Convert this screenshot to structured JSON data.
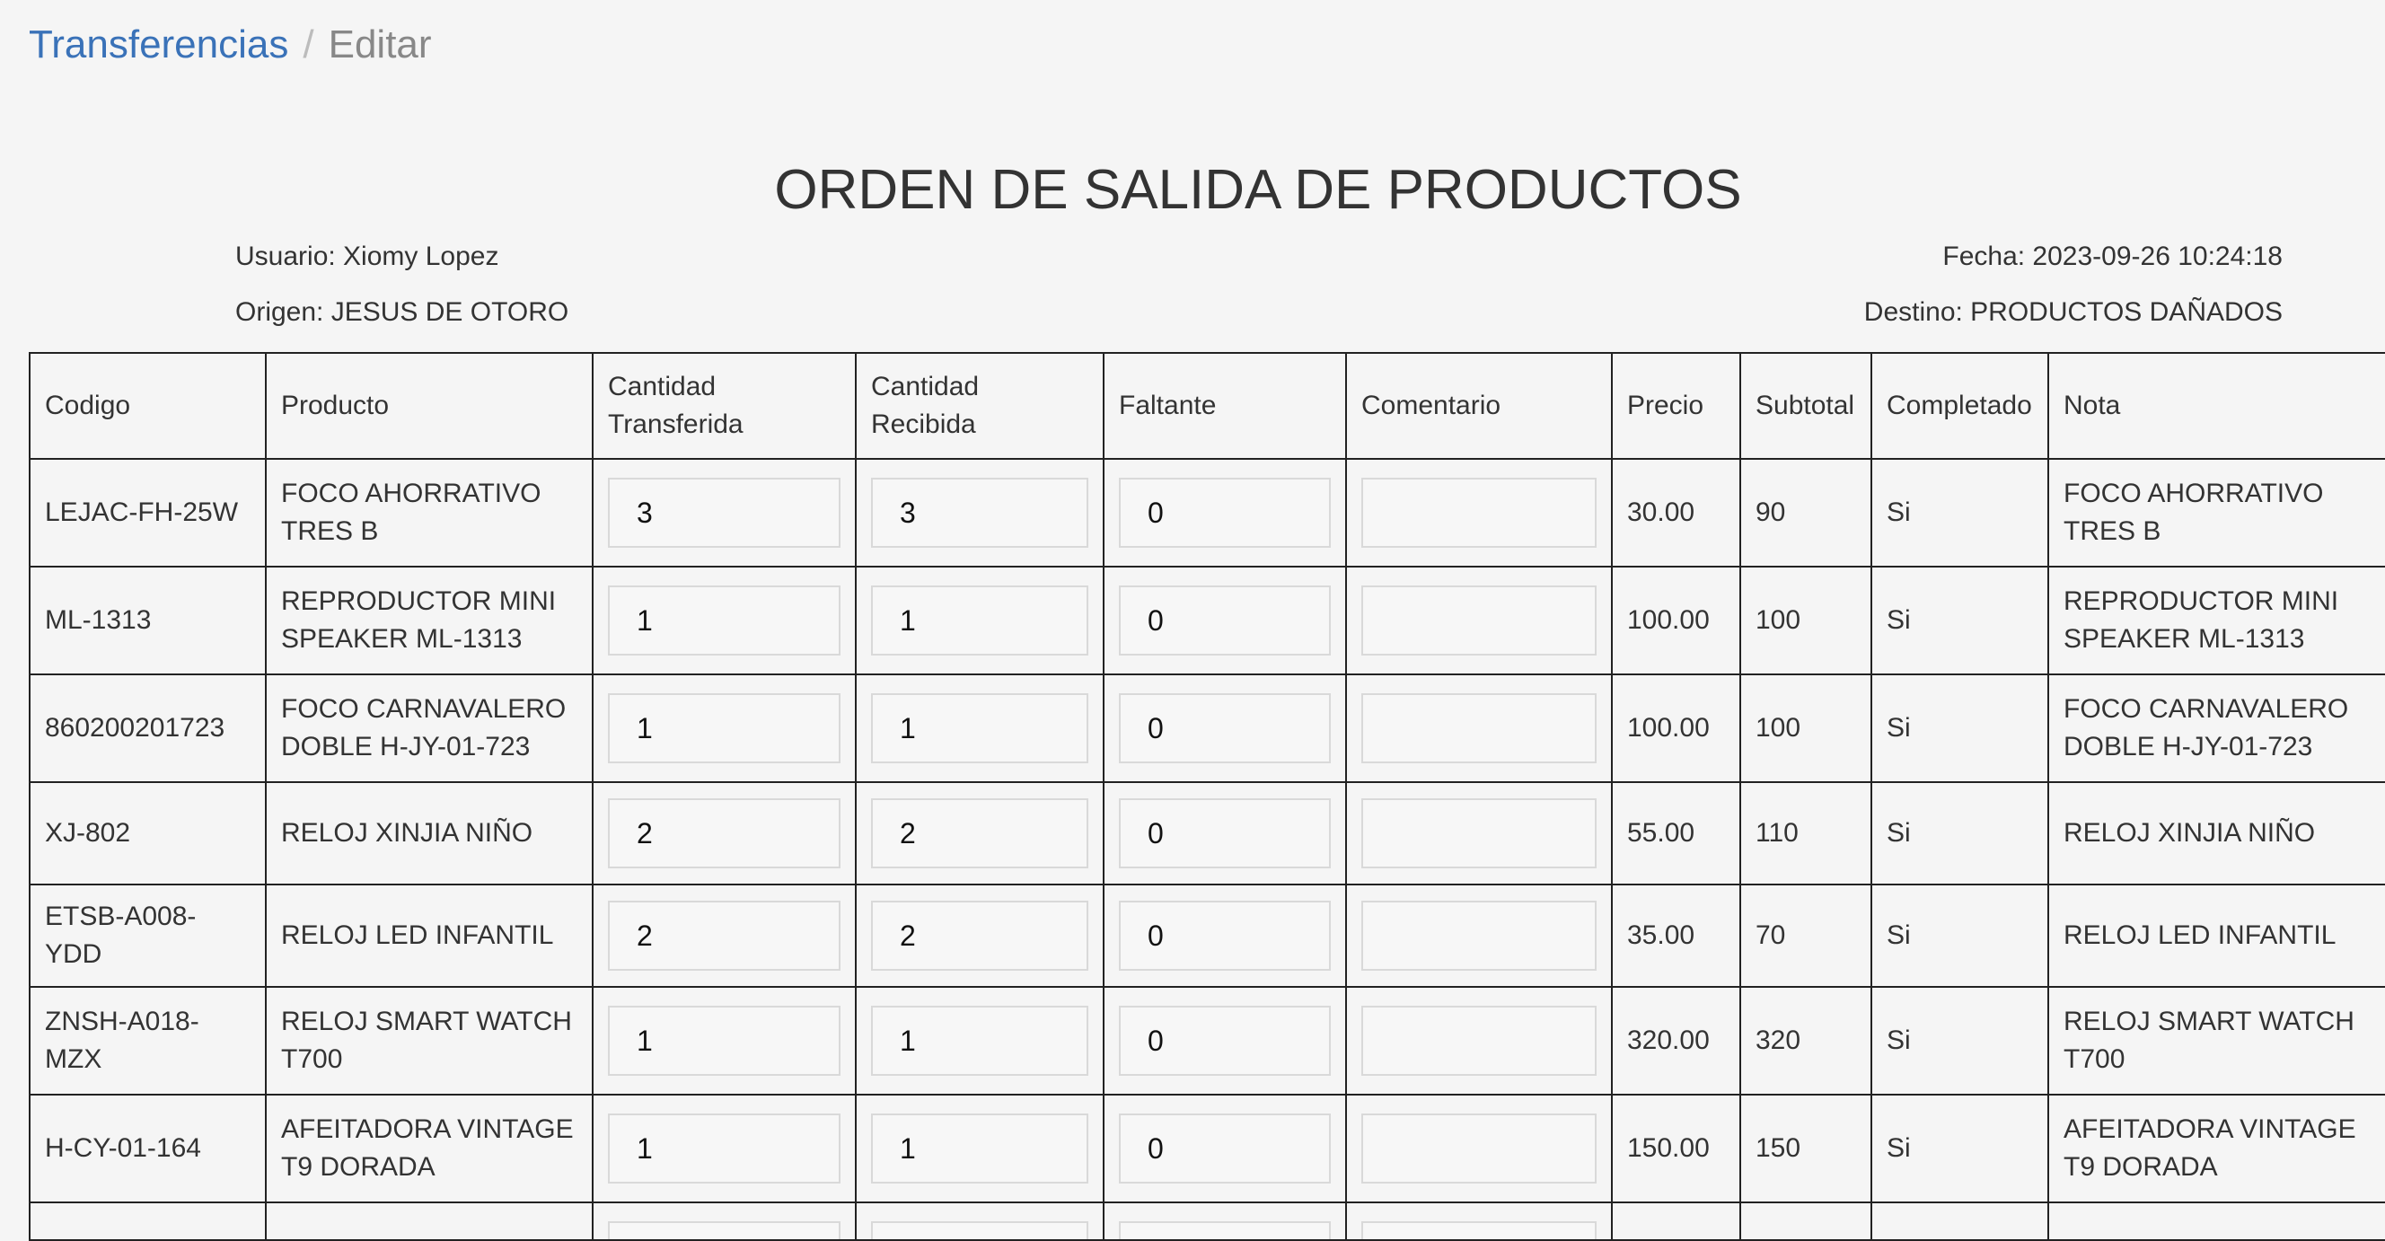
{
  "breadcrumb": {
    "parent": "Transferencias",
    "separator": "/",
    "current": "Editar"
  },
  "title": "ORDEN DE SALIDA DE PRODUCTOS",
  "meta": {
    "usuario": "Usuario: Xiomy Lopez",
    "origen": "Origen: JESUS DE OTORO",
    "fecha": "Fecha: 2023-09-26 10:24:18",
    "destino": "Destino: PRODUCTOS DAÑADOS"
  },
  "table": {
    "headers": [
      "Codigo",
      "Producto",
      "Cantidad Transferida",
      "Cantidad Recibida",
      "Faltante",
      "Comentario",
      "Precio",
      "Subtotal",
      "Completado",
      "Nota"
    ],
    "rows": [
      {
        "codigo": "LEJAC-FH-25W",
        "producto": "FOCO AHORRATIVO TRES B",
        "transferida": "3",
        "recibida": "3",
        "faltante": "0",
        "comentario": "",
        "precio": "30.00",
        "subtotal": "90",
        "completado": "Si",
        "nota": "FOCO AHORRATIVO TRES B"
      },
      {
        "codigo": "ML-1313",
        "producto": "REPRODUCTOR MINI SPEAKER ML-1313",
        "transferida": "1",
        "recibida": "1",
        "faltante": "0",
        "comentario": "",
        "precio": "100.00",
        "subtotal": "100",
        "completado": "Si",
        "nota": "REPRODUCTOR MINI SPEAKER ML-1313"
      },
      {
        "codigo": "860200201723",
        "producto": "FOCO CARNAVALERO DOBLE H-JY-01-723",
        "transferida": "1",
        "recibida": "1",
        "faltante": "0",
        "comentario": "",
        "precio": "100.00",
        "subtotal": "100",
        "completado": "Si",
        "nota": "FOCO CARNAVALERO DOBLE H-JY-01-723"
      },
      {
        "codigo": "XJ-802",
        "producto": "RELOJ XINJIA NIÑO",
        "transferida": "2",
        "recibida": "2",
        "faltante": "0",
        "comentario": "",
        "precio": "55.00",
        "subtotal": "110",
        "completado": "Si",
        "nota": "RELOJ XINJIA NIÑO"
      },
      {
        "codigo": "ETSB-A008-YDD",
        "producto": "RELOJ LED INFANTIL",
        "transferida": "2",
        "recibida": "2",
        "faltante": "0",
        "comentario": "",
        "precio": "35.00",
        "subtotal": "70",
        "completado": "Si",
        "nota": "RELOJ LED INFANTIL"
      },
      {
        "codigo": "ZNSH-A018-MZX",
        "producto": "RELOJ SMART WATCH T700",
        "transferida": "1",
        "recibida": "1",
        "faltante": "0",
        "comentario": "",
        "precio": "320.00",
        "subtotal": "320",
        "completado": "Si",
        "nota": "RELOJ SMART WATCH T700"
      },
      {
        "codigo": "H-CY-01-164",
        "producto": "AFEITADORA VINTAGE T9 DORADA",
        "transferida": "1",
        "recibida": "1",
        "faltante": "0",
        "comentario": "",
        "precio": "150.00",
        "subtotal": "150",
        "completado": "Si",
        "nota": "AFEITADORA VINTAGE T9 DORADA"
      }
    ]
  }
}
